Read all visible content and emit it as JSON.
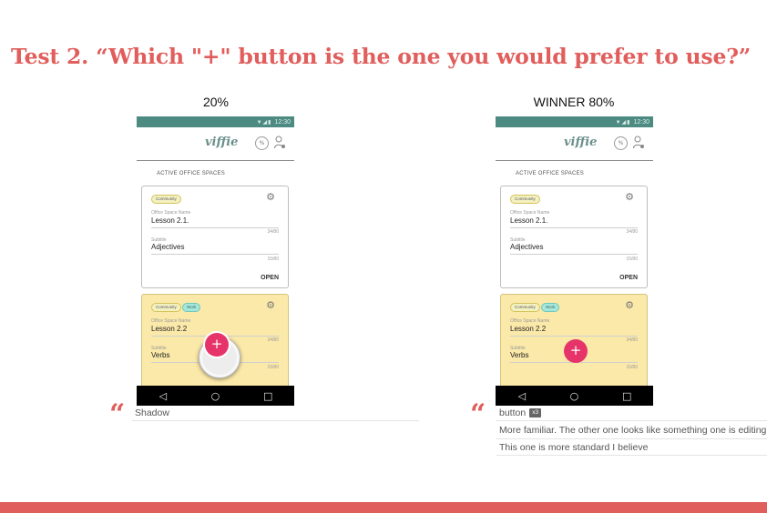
{
  "slide": {
    "title": "Test 2. “Which \"+\" button is the one you would prefer to use?”",
    "accent_color": "#e05e5c",
    "brand_color": "#6a8f8a",
    "fab_color": "#e6346b"
  },
  "variants": [
    {
      "result_label": "20%",
      "vote_share_percent": 20,
      "phone": {
        "status_time": "12:30",
        "brand": "viffie",
        "section_label": "ACTIVE OFFICE SPACES",
        "cards": [
          {
            "tags": [
              "Community"
            ],
            "name_label": "Office Space Name",
            "name_value": "Lesson 2.1.",
            "name_counter": "34/80",
            "subtitle_label": "Subtitle",
            "subtitle_value": "Adjectives",
            "subtitle_counter": "15/80",
            "action": "OPEN"
          },
          {
            "tags": [
              "Community",
              "Work"
            ],
            "name_label": "Office Space Name",
            "name_value": "Lesson 2.2",
            "name_counter": "34/80",
            "subtitle_label": "Subtitle",
            "subtitle_value": "Verbs",
            "subtitle_counter": "15/80"
          }
        ],
        "fab_label": "+",
        "nav": [
          "◁",
          "○",
          "□"
        ]
      },
      "comments": [
        {
          "text": "Shadow"
        }
      ]
    },
    {
      "result_label": "WINNER 80%",
      "vote_share_percent": 80,
      "phone": {
        "status_time": "12:30",
        "brand": "viffie",
        "section_label": "ACTIVE OFFICE SPACES",
        "cards": [
          {
            "tags": [
              "Community"
            ],
            "name_label": "Office Space Name",
            "name_value": "Lesson 2.1.",
            "name_counter": "34/80",
            "subtitle_label": "Subtitle",
            "subtitle_value": "Adjectives",
            "subtitle_counter": "15/80",
            "action": "OPEN"
          },
          {
            "tags": [
              "Community",
              "Work"
            ],
            "name_label": "Office Space Name",
            "name_value": "Lesson 2.2",
            "name_counter": "34/80",
            "subtitle_label": "Subtitle",
            "subtitle_value": "Verbs",
            "subtitle_counter": "15/80"
          }
        ],
        "fab_label": "+",
        "nav": [
          "◁",
          "○",
          "□"
        ]
      },
      "comments": [
        {
          "text": "button",
          "badge": "x3"
        },
        {
          "text": "More familiar. The other one looks like something one is editing"
        },
        {
          "text": "This one is more standard I believe"
        }
      ]
    }
  ]
}
